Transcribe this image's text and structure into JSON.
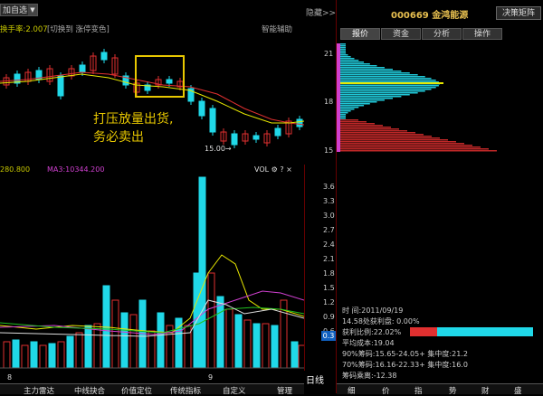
{
  "toolbar": {
    "add_watch": "加自选",
    "hide": "隐藏>>",
    "decision_matrix": "决策矩阵",
    "smart_assist": "智能辅助"
  },
  "stock": {
    "code": "000669",
    "name": "金鸿能源",
    "title": "000669 金鸿能源"
  },
  "info_line": {
    "left": "换手率:2.007",
    "right": "[切换到 涨停变色]"
  },
  "annotation": {
    "line1": "打压放量出货,",
    "line2": "务必卖出"
  },
  "price_low_label": "15.00→",
  "volume": {
    "ma_label": "280.800",
    "ma3_label": "MA3:10344.200",
    "vol_label": "VOL"
  },
  "volume_axis": [
    "3.6",
    "3.3",
    "3.0",
    "2.7",
    "2.4",
    "2.1",
    "1.8",
    "1.5",
    "1.2",
    "0.9",
    "0.6",
    "0.3"
  ],
  "volume_axis_current": "0.3",
  "x_ticks": [
    "8",
    "9"
  ],
  "side_tabs": [
    "报价",
    "资金",
    "分析",
    "操作"
  ],
  "chip_axis": [
    "21",
    "18",
    "15"
  ],
  "chip_info": {
    "date_label": "时    间:2011/09/19",
    "profit_at_price": "14.58处获利盘: 0.00%",
    "profit_ratio": "获利比例:22.02%",
    "avg_cost": "平均成本:19.04",
    "chip90": "90%筹码:15.65-24.05+ 集中度:21.2",
    "chip70": "70%筹码:16.16-22.33+ 集中度:16.0",
    "chip_spread": "筹码乘离:-12.38"
  },
  "bottom_tabs": [
    "主力雷达",
    "中线抉合",
    "价值定位",
    "传统指标",
    "自定义",
    "管理"
  ],
  "right_bottom_tabs": [
    "细",
    "价",
    "指",
    "势",
    "财",
    "盛"
  ],
  "week_line": "日线",
  "colors": {
    "up": "#e03030",
    "down": "#20d8e8",
    "ma_yellow": "#e8e800",
    "ma_red": "#e03030",
    "ma_magenta": "#d040d0",
    "highlight": "#e8c800"
  }
}
